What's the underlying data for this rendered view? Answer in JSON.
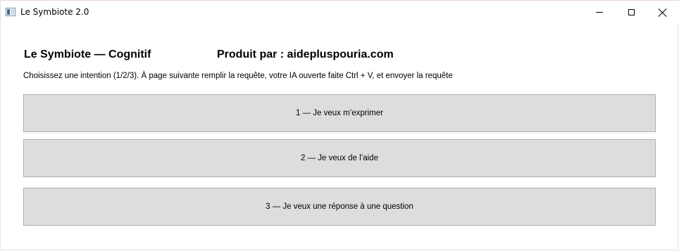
{
  "window": {
    "title": "Le Symbiote 2.0",
    "icon": "app-window-icon",
    "controls": [
      "minimize-icon",
      "maximize-icon",
      "close-icon"
    ]
  },
  "header": {
    "title": "Le Symbiote — Cognitif",
    "producer": "Produit par : aidepluspouria.com"
  },
  "instruction": "Choisissez une intention (1/2/3). À page suivante remplir la requête, votre IA ouverte faite Ctrl + V, et envoyer la requête",
  "options": [
    {
      "label": "1 — Je veux m’exprimer"
    },
    {
      "label": "2 — Je veux de l’aide"
    },
    {
      "label": "3 — Je veux une réponse à une question"
    }
  ],
  "colors": {
    "button_bg": "#dddddd",
    "button_border": "#adadad",
    "window_bg": "#ffffff"
  }
}
